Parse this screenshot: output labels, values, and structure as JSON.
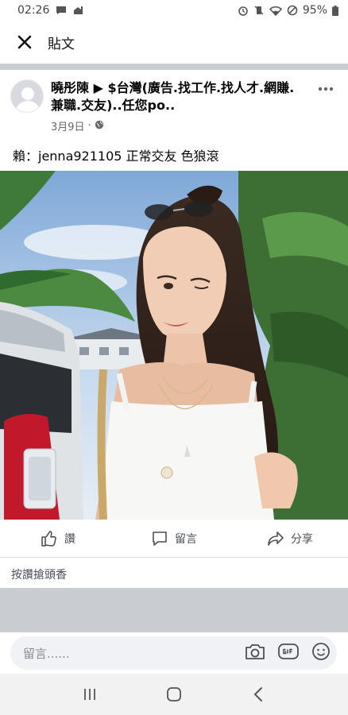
{
  "status_bar": {
    "time": "02:26",
    "battery": "95%"
  },
  "header": {
    "title": "貼文"
  },
  "post": {
    "author_line": "曉彤陳 ▶ $台灣(廣告.找工作.找人才.網賺.兼職.交友)..任您po..",
    "date": "3月9日",
    "privacy_icon": "globe-icon",
    "body_text": "賴：jenna921105 正常交友 色狼滾"
  },
  "actions": {
    "like": "讚",
    "comment": "留言",
    "share": "分享"
  },
  "reactions": {
    "first_like_text": "按讚搶頭香"
  },
  "comment_composer": {
    "placeholder": "留言......"
  },
  "colors": {
    "divider": "#c9ccd1",
    "meta_text": "#65676b",
    "nav_bar": "#f2f2f2"
  }
}
